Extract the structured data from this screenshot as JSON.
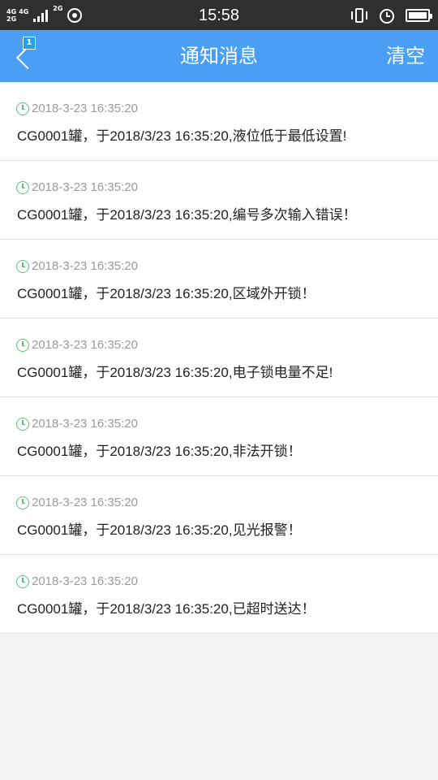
{
  "status_bar": {
    "net1": "4G",
    "net2": "4G",
    "net3": "2G",
    "net4": "2G",
    "time": "15:58"
  },
  "header": {
    "title": "通知消息",
    "clear_label": "清空",
    "back_badge": "1"
  },
  "notifications": [
    {
      "time": "2018-3-23  16:35:20",
      "message": "CG0001罐，于2018/3/23  16:35:20,液位低于最低设置!"
    },
    {
      "time": "2018-3-23  16:35:20",
      "message": "CG0001罐，于2018/3/23  16:35:20,编号多次输入错误！"
    },
    {
      "time": "2018-3-23  16:35:20",
      "message": "CG0001罐，于2018/3/23  16:35:20,区域外开锁！"
    },
    {
      "time": "2018-3-23  16:35:20",
      "message": "CG0001罐，于2018/3/23  16:35:20,电子锁电量不足!"
    },
    {
      "time": "2018-3-23  16:35:20",
      "message": "CG0001罐，于2018/3/23  16:35:20,非法开锁！"
    },
    {
      "time": "2018-3-23  16:35:20",
      "message": "CG0001罐，于2018/3/23  16:35:20,见光报警！"
    },
    {
      "time": "2018-3-23  16:35:20",
      "message": "CG0001罐，于2018/3/23  16:35:20,已超时送达！"
    }
  ]
}
